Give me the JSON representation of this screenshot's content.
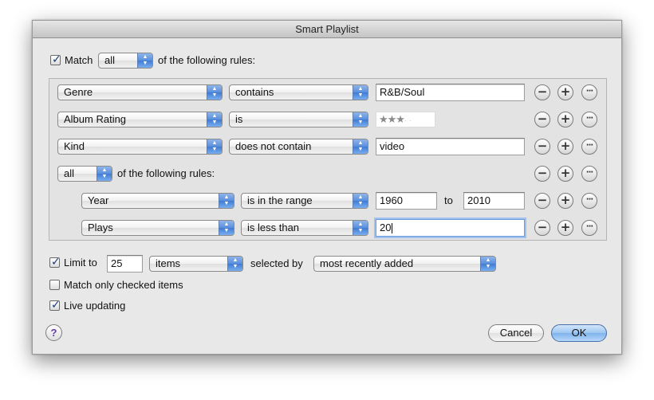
{
  "window": {
    "title": "Smart Playlist"
  },
  "match": {
    "checked": true,
    "label": "Match",
    "value": "all",
    "suffix": "of the following rules:"
  },
  "rules": [
    {
      "field": "Genre",
      "operator": "contains",
      "value": "R&B/Soul"
    },
    {
      "field": "Album Rating",
      "operator": "is",
      "rating_stars": 3,
      "rating_display": "★★★"
    },
    {
      "field": "Kind",
      "operator": "does not contain",
      "value": "video"
    }
  ],
  "nested": {
    "value": "all",
    "suffix": "of the following rules:",
    "rules": [
      {
        "field": "Year",
        "operator": "is in the range",
        "value": "1960",
        "to_label": "to",
        "value2": "2010"
      },
      {
        "field": "Plays",
        "operator": "is less than",
        "value": "20"
      }
    ]
  },
  "limit": {
    "checked": true,
    "label": "Limit to",
    "value": "25",
    "unit": "items",
    "selected_by_label": "selected by",
    "selected_by": "most recently added"
  },
  "match_checked": {
    "checked": false,
    "label": "Match only checked items"
  },
  "live_updating": {
    "checked": true,
    "label": "Live updating"
  },
  "rule_buttons": {
    "remove": "−",
    "add": "+",
    "more": "···"
  },
  "buttons": {
    "help": "?",
    "cancel": "Cancel",
    "ok": "OK"
  },
  "colors": {
    "accent": "#5a8fdc",
    "focus_ring": "#9fc1f0",
    "default_button": "#9cc5f1",
    "help_icon": "#6a3aa8"
  },
  "icons": {
    "checkbox_mark": "✓",
    "popup_up": "▲",
    "popup_down": "▼"
  }
}
